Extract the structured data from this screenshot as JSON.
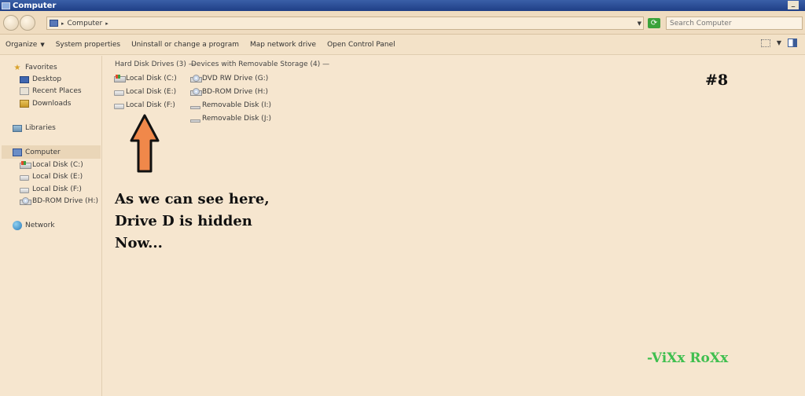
{
  "window": {
    "title": "Computer"
  },
  "address": {
    "path": [
      "Computer"
    ],
    "search_placeholder": "Search Computer"
  },
  "toolbar": {
    "organize": "Organize",
    "system_properties": "System properties",
    "uninstall": "Uninstall or change a program",
    "map_drive": "Map network drive",
    "control_panel": "Open Control Panel"
  },
  "sidebar": {
    "favorites": "Favorites",
    "desktop": "Desktop",
    "recent_places": "Recent Places",
    "downloads": "Downloads",
    "libraries": "Libraries",
    "computer": "Computer",
    "drives": [
      "Local Disk (C:)",
      "Local Disk (E:)",
      "Local Disk (F:)",
      "BD-ROM Drive (H:)"
    ],
    "network": "Network"
  },
  "content": {
    "hdd_header": "Hard Disk Drives (3) —",
    "hdd_items": [
      "Local Disk (C:)",
      "Local Disk (E:)",
      "Local Disk (F:)"
    ],
    "removable_header": "Devices with Removable Storage (4) —",
    "removable_items": [
      "DVD RW Drive (G:)",
      "BD-ROM Drive (H:)",
      "Removable Disk (I:)",
      "Removable Disk (J:)"
    ]
  },
  "overlay": {
    "slide_number": "#8",
    "annotation_lines": [
      "As we can see here,",
      "Drive D is hidden",
      "Now..."
    ],
    "signature": "-ViXx RoXx",
    "arrow_color": "#f0884a",
    "signature_color": "#3fbf4f"
  }
}
